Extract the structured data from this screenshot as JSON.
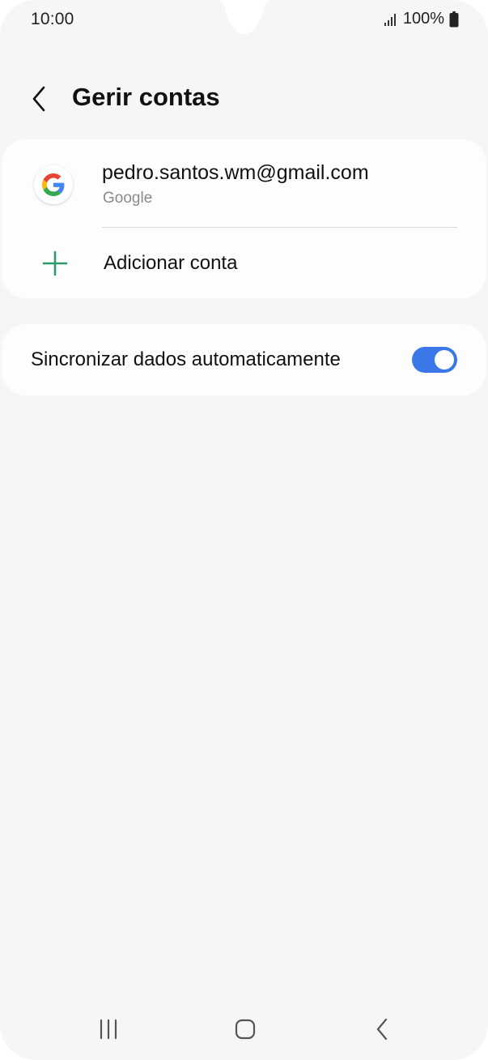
{
  "status_bar": {
    "time": "10:00",
    "battery": "100%",
    "icons": [
      "signal-icon",
      "battery-icon"
    ]
  },
  "header": {
    "back_icon": "chevron-left-icon",
    "title": "Gerir contas"
  },
  "accounts": [
    {
      "email": "pedro.santos.wm@gmail.com",
      "provider": "Google",
      "icon": "google-logo-icon"
    }
  ],
  "add_account": {
    "label": "Adicionar conta",
    "icon": "plus-icon"
  },
  "sync": {
    "label": "Sincronizar dados automaticamente",
    "enabled": true
  },
  "nav_bar": {
    "buttons": [
      "recent-apps-icon",
      "home-icon",
      "back-icon"
    ]
  },
  "colors": {
    "background": "#f6f6f8",
    "card": "#fdfdfe",
    "accent": "#3a78e8",
    "plus_green": "#2a9d6a",
    "secondary_text": "#8a8a8a"
  }
}
